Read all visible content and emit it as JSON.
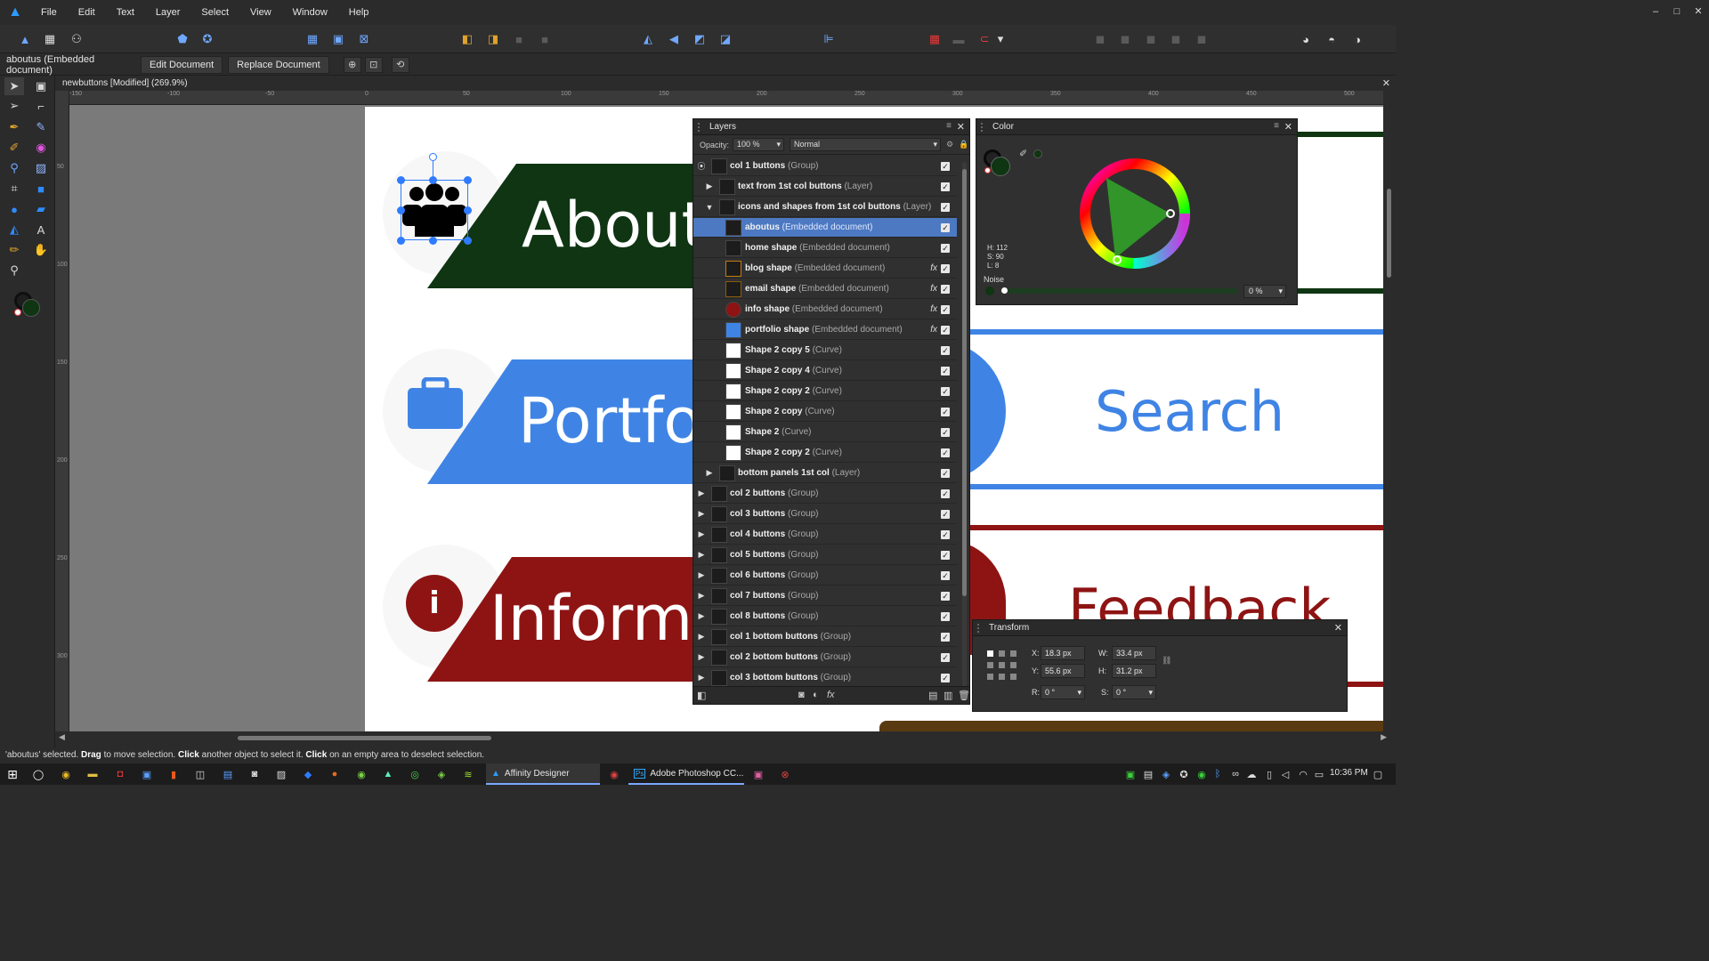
{
  "menu": {
    "items": [
      "File",
      "Edit",
      "Text",
      "Layer",
      "Select",
      "View",
      "Window",
      "Help"
    ],
    "window_controls": [
      "–",
      "□",
      "✕"
    ]
  },
  "context": {
    "title": "aboutus (Embedded document)",
    "edit_btn": "Edit Document",
    "replace_btn": "Replace Document"
  },
  "document": {
    "tab_title": "newbuttons [Modified] (269.9%)"
  },
  "ruler": {
    "h_labels": [
      "-150",
      "-100",
      "-50",
      "0",
      "50",
      "100",
      "150",
      "200",
      "250",
      "300",
      "350",
      "400",
      "450",
      "500"
    ],
    "v_labels": [
      "50",
      "100",
      "150",
      "200",
      "250",
      "300"
    ]
  },
  "canvas": {
    "about": "About",
    "portfolio": "Portfo",
    "information": "Informa",
    "search": "Search",
    "feedback": "Feedback",
    "info_glyph": "i",
    "colors": {
      "green": "#0f3512",
      "blue": "#3f84e5",
      "red": "#8e1414",
      "brown": "#5a3a10"
    }
  },
  "layers_panel": {
    "title": "Layers",
    "opacity_label": "Opacity:",
    "opacity_value": "100 %",
    "blend_mode": "Normal",
    "rows": [
      {
        "name": "col 1 buttons",
        "type": "(Group)"
      },
      {
        "name": "text from 1st col buttons",
        "type": "(Layer)"
      },
      {
        "name": "icons and shapes from 1st col buttons",
        "type": "(Layer)"
      },
      {
        "name": "aboutus",
        "type": "(Embedded document)"
      },
      {
        "name": "home shape",
        "type": "(Embedded document)"
      },
      {
        "name": "blog shape",
        "type": "(Embedded document)"
      },
      {
        "name": "email shape",
        "type": "(Embedded document)"
      },
      {
        "name": "info shape",
        "type": "(Embedded document)"
      },
      {
        "name": "portfolio shape",
        "type": "(Embedded document)"
      },
      {
        "name": "Shape 2 copy 5",
        "type": "(Curve)"
      },
      {
        "name": "Shape 2 copy 4",
        "type": "(Curve)"
      },
      {
        "name": "Shape 2 copy 2",
        "type": "(Curve)"
      },
      {
        "name": "Shape 2 copy",
        "type": "(Curve)"
      },
      {
        "name": "Shape 2",
        "type": "(Curve)"
      },
      {
        "name": "Shape 2 copy 2",
        "type": "(Curve)"
      },
      {
        "name": "bottom panels 1st col",
        "type": "(Layer)"
      },
      {
        "name": "col 2 buttons",
        "type": "(Group)"
      },
      {
        "name": "col 3 buttons",
        "type": "(Group)"
      },
      {
        "name": "col 4 buttons",
        "type": "(Group)"
      },
      {
        "name": "col 5 buttons",
        "type": "(Group)"
      },
      {
        "name": "col 6 buttons",
        "type": "(Group)"
      },
      {
        "name": "col 7 buttons",
        "type": "(Group)"
      },
      {
        "name": "col 8 buttons",
        "type": "(Group)"
      },
      {
        "name": "col 1 bottom buttons",
        "type": "(Group)"
      },
      {
        "name": "col 2 bottom buttons",
        "type": "(Group)"
      },
      {
        "name": "col 3 bottom buttons",
        "type": "(Group)"
      }
    ]
  },
  "color_panel": {
    "title": "Color",
    "h": "H: 112",
    "s": "S: 90",
    "l": "L: 8",
    "noise_label": "Noise",
    "noise_value": "0 %",
    "fill_color": "#0f3512"
  },
  "transform_panel": {
    "title": "Transform",
    "x_label": "X:",
    "x": "18.3 px",
    "y_label": "Y:",
    "y": "55.6 px",
    "w_label": "W:",
    "w": "33.4 px",
    "h_label": "H:",
    "h": "31.2 px",
    "r_label": "R:",
    "r": "0 °",
    "s_label": "S:",
    "s": "0 °"
  },
  "status": {
    "selected": "'aboutus' selected.",
    "drag_bold": "Drag",
    "drag_text": "to move selection.",
    "click1_bold": "Click",
    "click1_text": "another object to select it.",
    "click2_bold": "Click",
    "click2_text": "on an empty area to deselect selection."
  },
  "taskbar": {
    "app1": "Affinity Designer",
    "app2": "Adobe Photoshop CC...",
    "time": "10:36 PM"
  }
}
